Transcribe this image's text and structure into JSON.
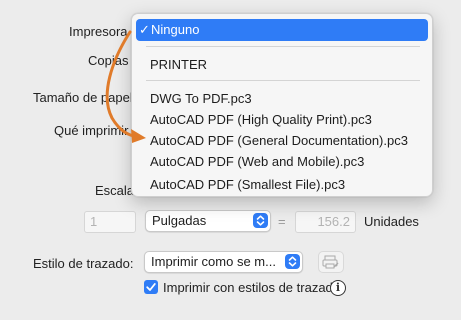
{
  "dialog": {
    "labels": {
      "printer": "Impresora",
      "copies": "Copias",
      "paper_size": "Tamaño de papel",
      "what_to_print": "Qué imprimir",
      "scale": "Escala"
    },
    "scale_row": {
      "value_left": "1",
      "units_select": "Pulgadas",
      "equals": "=",
      "value_right": "156.2",
      "units_label": "Unidades"
    },
    "plot_style": {
      "label": "Estilo de trazado:",
      "select": "Imprimir como se m...",
      "checkbox_label": "Imprimir con estilos de trazado",
      "checkbox_checked": true,
      "info_glyph": "i"
    }
  },
  "printer_menu": {
    "selected": "Ninguno",
    "check_glyph": "✓",
    "items": [
      "PRINTER",
      "DWG To PDF.pc3",
      "AutoCAD PDF (High Quality Print).pc3",
      "AutoCAD PDF (General Documentation).pc3",
      "AutoCAD PDF (Web and Mobile).pc3",
      "AutoCAD PDF (Smallest File).pc3"
    ]
  },
  "colors": {
    "accent": "#2f7cf6",
    "annotation_arrow": "#e07b2a",
    "window_bg": "#ececec"
  }
}
